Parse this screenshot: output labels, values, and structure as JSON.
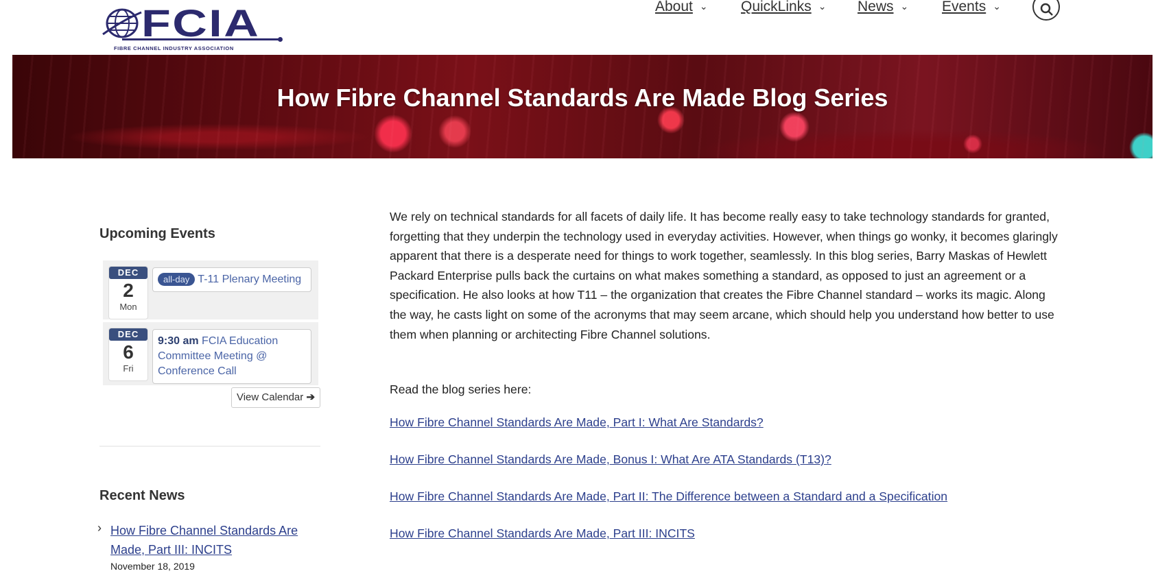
{
  "header": {
    "logo_text": "FCIA",
    "logo_tagline": "FIBRE CHANNEL INDUSTRY ASSOCIATION",
    "nav": [
      {
        "label": "About"
      },
      {
        "label": "QuickLinks"
      },
      {
        "label": "News"
      },
      {
        "label": "Events"
      }
    ],
    "search_icon": "search-icon"
  },
  "banner": {
    "title": "How Fibre Channel Standards Are Made Blog Series"
  },
  "sidebar": {
    "upcoming_heading": "Upcoming Events",
    "events": [
      {
        "month": "DEC",
        "day": "2",
        "weekday": "Mon",
        "badge": "all-day",
        "time": "",
        "title": "T-11 Plenary Meeting"
      },
      {
        "month": "DEC",
        "day": "6",
        "weekday": "Fri",
        "badge": "",
        "time": "9:30 am",
        "title": "FCIA Education Committee Meeting @ Conference Call"
      }
    ],
    "view_calendar_label": "View Calendar",
    "news_heading": "Recent News",
    "news": [
      {
        "title": "How Fibre Channel Standards Are Made, Part III: INCITS",
        "date": "November 18, 2019"
      }
    ]
  },
  "main": {
    "intro": "We rely on technical standards for all facets of daily life. It has become really easy to take technology standards for granted, forgetting that they underpin the technology used in everyday activities. However, when things go wonky, it becomes glaringly apparent that there is a desperate need for things to work together, seamlessly. In this blog series, Barry Maskas of Hewlett Packard Enterprise pulls back the curtains on what makes something a standard, as opposed to just an agreement or a specification. He also looks at how T11 – the organization that creates the Fibre Channel standard – works its magic. Along the way, he casts light on some of the acronyms that may seem arcane, which should help you understand how better to use them when planning or architecting Fibre Channel solutions.",
    "lead_in": "Read the blog series here:",
    "links": [
      {
        "label": "How Fibre Channel Standards Are Made, Part I: What Are Standards?"
      },
      {
        "label": "How Fibre Channel Standards Are Made, Bonus I: What Are ATA Standards (T13)?"
      },
      {
        "label": "How Fibre Channel Standards Are Made, Part II: The Difference between a Standard and a Specification"
      },
      {
        "label": "How Fibre Channel Standards Are Made, Part III: INCITS"
      }
    ]
  }
}
